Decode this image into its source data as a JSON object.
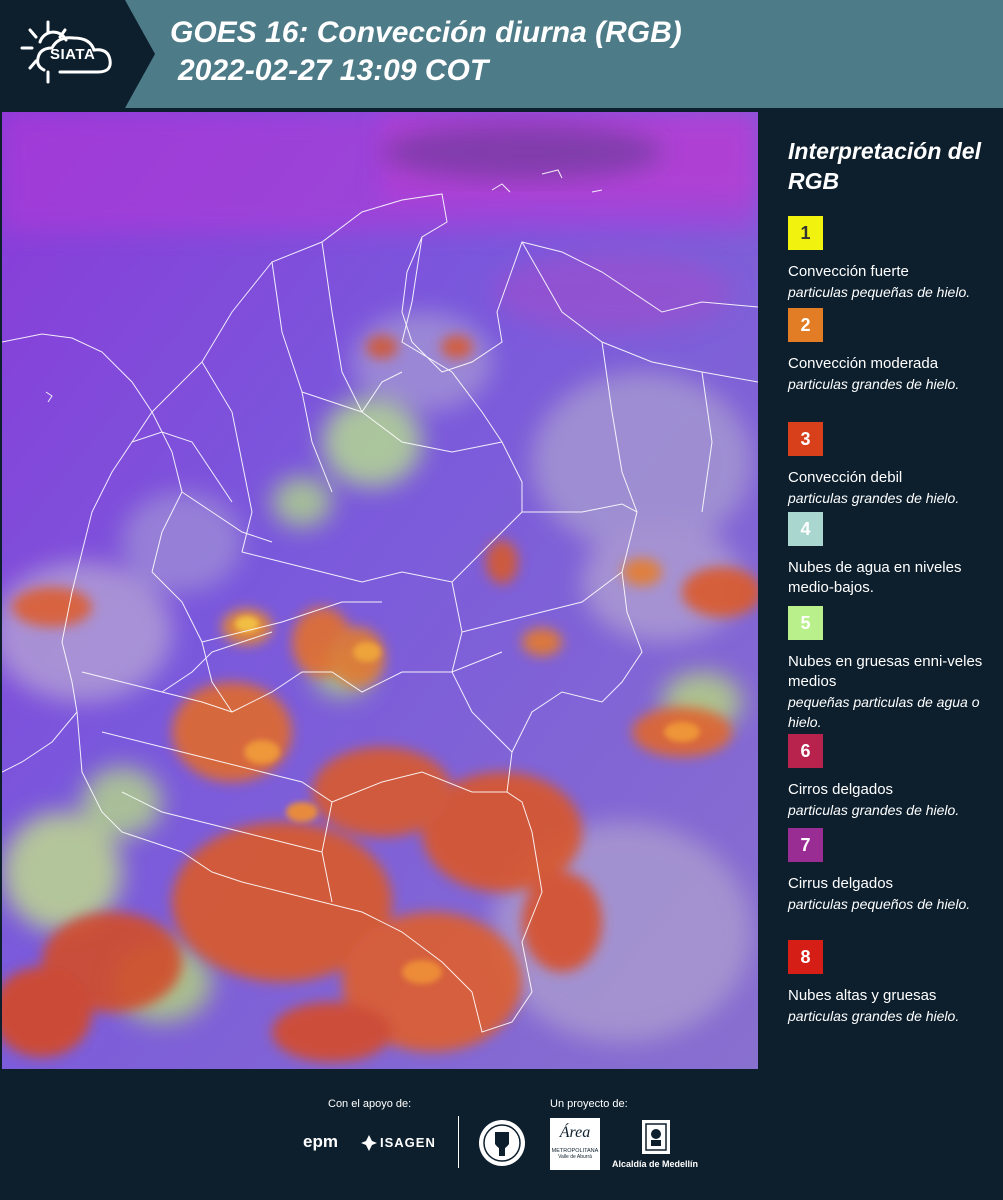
{
  "header": {
    "logo_text": "SIATA",
    "title_line1": "GOES 16: Convección diurna (RGB)",
    "title_line2": "2022-02-27 13:09 COT"
  },
  "legend": {
    "title": "Interpretación del RGB",
    "items": [
      {
        "number": "1",
        "color": "#f2f20f",
        "number_color": "#333333",
        "label": "Convección fuerte",
        "sub": "particulas pequeñas de hielo."
      },
      {
        "number": "2",
        "color": "#e27c25",
        "number_color": "#ffffff",
        "label": "Convección moderada",
        "sub": "particulas grandes de hielo."
      },
      {
        "number": "3",
        "color": "#d8401b",
        "number_color": "#ffffff",
        "label": "Convección debil",
        "sub": "particulas grandes de hielo."
      },
      {
        "number": "4",
        "color": "#a9d7cf",
        "number_color": "#ffffff",
        "label": "Nubes de agua en niveles medio-bajos.",
        "sub": ""
      },
      {
        "number": "5",
        "color": "#b9f08b",
        "number_color": "#ffffff",
        "label": "Nubes en gruesas enni-veles medios",
        "sub": "pequeñas particulas de agua o hielo."
      },
      {
        "number": "6",
        "color": "#b8234d",
        "number_color": "#ffffff",
        "label": "Cirros delgados",
        "sub": "particulas grandes de hielo."
      },
      {
        "number": "7",
        "color": "#9a2d94",
        "number_color": "#ffffff",
        "label": "Cirrus delgados",
        "sub": "particulas pequeños de hielo."
      },
      {
        "number": "8",
        "color": "#d41e16",
        "number_color": "#ffffff",
        "label": "Nubes altas y gruesas",
        "sub": "particulas grandes de hielo."
      }
    ]
  },
  "footer": {
    "support_label": "Con el apoyo de:",
    "project_label": "Un proyecto de:",
    "epm": "epm",
    "isagen": "ISAGEN",
    "area_text": "Área",
    "metro_text": "METROPOLITANA",
    "valle_text": "Valle de Aburrá",
    "alcaldia": "Alcaldía de Medellín"
  }
}
